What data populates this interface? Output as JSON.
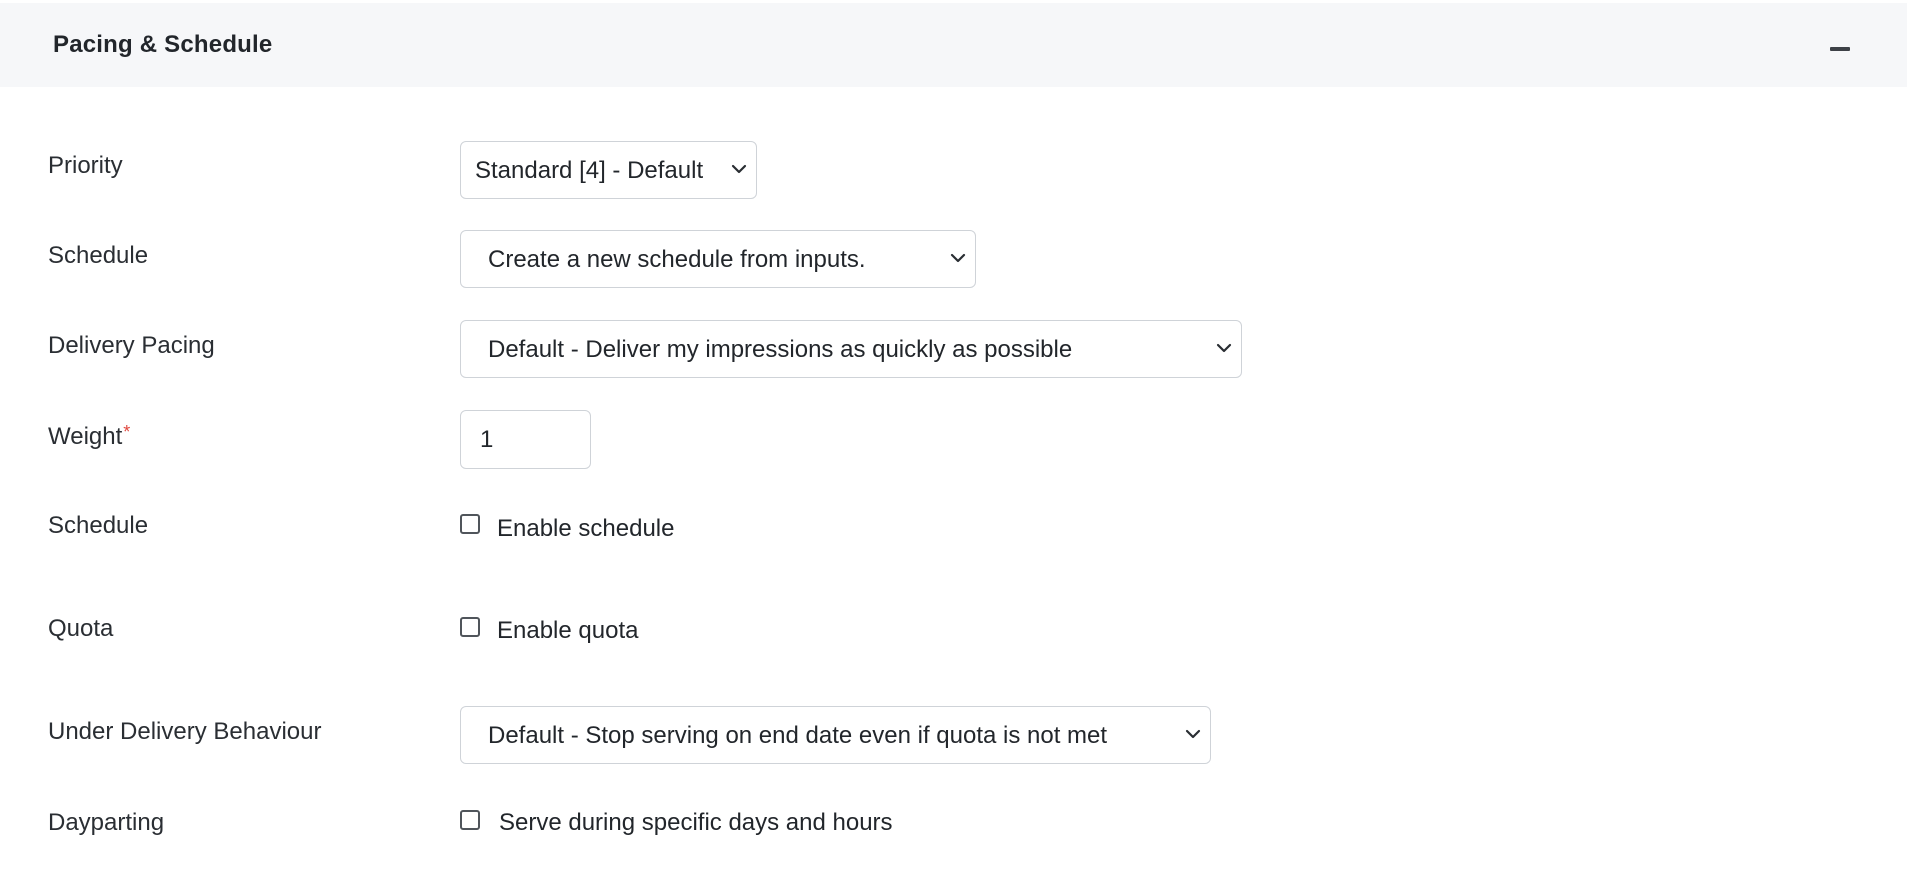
{
  "section": {
    "title": "Pacing & Schedule",
    "collapse_icon": "minus-icon"
  },
  "fields": {
    "priority": {
      "label": "Priority",
      "value": "Standard [4] - Default"
    },
    "schedule_select": {
      "label": "Schedule",
      "value": "Create a new schedule from inputs."
    },
    "delivery_pacing": {
      "label": "Delivery Pacing",
      "value": "Default - Deliver my impressions as quickly as possible"
    },
    "weight": {
      "label": "Weight",
      "required_mark": "*",
      "value": "1"
    },
    "schedule_toggle": {
      "label": "Schedule",
      "checkbox_label": "Enable schedule",
      "checked": false
    },
    "quota": {
      "label": "Quota",
      "checkbox_label": "Enable quota",
      "checked": false
    },
    "under_delivery": {
      "label": "Under Delivery Behaviour",
      "value": "Default - Stop serving on end date even if quota is not met"
    },
    "dayparting": {
      "label": "Dayparting",
      "checkbox_label": "Serve during specific days and hours",
      "checked": false
    }
  },
  "colors": {
    "header_bg": "#f6f7f9",
    "border": "#cfd3d8",
    "required": "#e0473e",
    "text": "#22262b"
  }
}
